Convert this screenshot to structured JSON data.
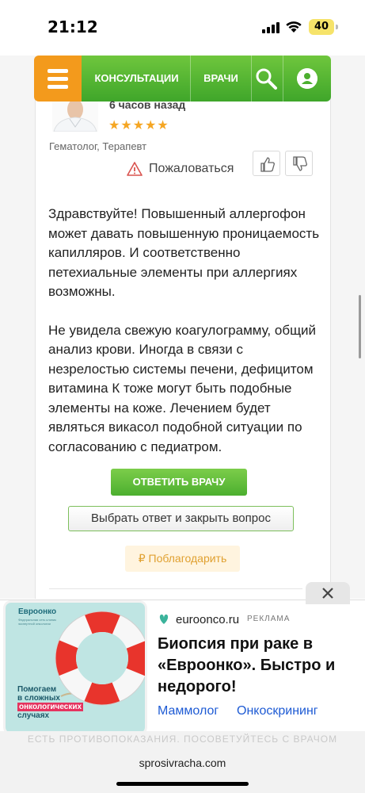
{
  "status_bar": {
    "time": "21:12",
    "battery": "40",
    "battery_color": "#f6e36a"
  },
  "nav": {
    "menu_icon": "hamburger-icon",
    "consultations": "КОНСУЛЬТАЦИИ",
    "doctors": "ВРАЧИ",
    "search_icon": "search-icon",
    "user_icon": "user-icon",
    "orange": "#f39a1c",
    "green": "#4caf2f"
  },
  "doctor": {
    "time_ago": "6 часов назад",
    "rating_stars": 5,
    "stars_text": "★★★★★",
    "specialty": "Гематолог, Терапевт",
    "complain_label": "Пожаловаться",
    "like_icon": "thumb-up-icon",
    "dislike_icon": "thumb-down-icon"
  },
  "answer": {
    "paragraph_1": "Здравствуйте! Повышенный аллергофон может давать повышенную проницаемость капилляров. И соответственно петехиальные элементы при аллергиях возможны.",
    "paragraph_2": "Не увидела свежую коагулограмму, общий анализ крови. Иногда в связи с незрелостью системы печени, дефицитом витамина К тоже могут быть подобные элементы на коже. Лечением будет являться викасол подобной ситуации по согласованию с педиатром."
  },
  "actions": {
    "reply": "ОТВЕТИТЬ ВРАЧУ",
    "choose_answer": "Выбрать ответ и закрыть вопрос",
    "thank": "₽ Поблагодарить"
  },
  "ad": {
    "close_icon": "close-icon",
    "logo": "Евроонко",
    "logo_sub": "Федеральная сеть клиник экспертной онкологии",
    "caption_line1": "Помогаем",
    "caption_line2": "в сложных",
    "caption_highlight": "онкологических",
    "caption_line4": "случаях",
    "site": "euroonco.ru",
    "label": "РЕКЛАМА",
    "headline": "Биопсия при раке в «Евроонко». Быстро и недорого!",
    "links": [
      "Маммолог",
      "Онкоскрининг"
    ],
    "warning": "ЕСТЬ ПРОТИВОПОКАЗАНИЯ. ПОСОВЕТУЙТЕСЬ С ВРАЧОМ"
  },
  "url_bar": {
    "domain": "sprosivracha.com"
  }
}
